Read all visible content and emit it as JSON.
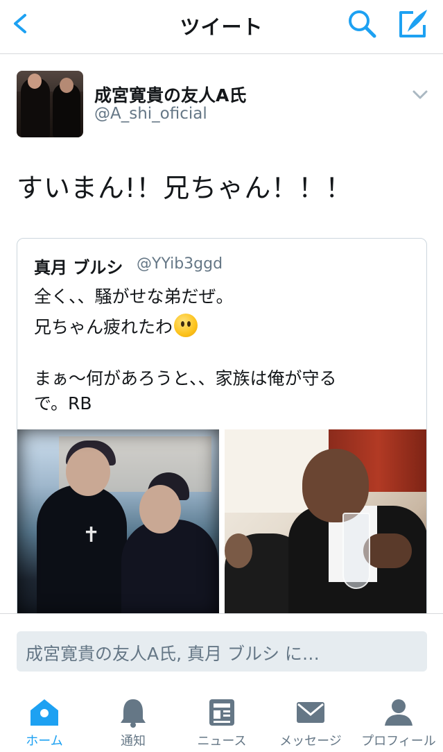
{
  "header": {
    "title": "ツイート",
    "back_icon": "chevron-left-icon",
    "search_icon": "search-icon",
    "compose_icon": "compose-tweet-icon",
    "accent_color": "#1da1f2"
  },
  "tweet": {
    "author_name": "成宮寛貴の友人A氏",
    "author_handle": "@A_shi_oficial",
    "text": "すいまん!！兄ちゃん！！！",
    "more_icon": "chevron-down-icon"
  },
  "quoted_tweet": {
    "author_name": "真月 ブルシ",
    "author_handle": "@YYib3ggd",
    "lines": [
      "全く、、騒がせな弟だぜ。",
      "兄ちゃん疲れたわ",
      "まぁ〜何があろうと、、家族は俺が守る",
      "で。RB"
    ],
    "emoji": "hushed-face-emoji"
  },
  "reply": {
    "placeholder": "成宮寛貴の友人A氏, 真月 ブルシ に…"
  },
  "tabbar": {
    "tabs": [
      {
        "label": "ホーム",
        "icon": "home-icon",
        "active": true
      },
      {
        "label": "通知",
        "icon": "bell-icon",
        "active": false
      },
      {
        "label": "ニュース",
        "icon": "news-icon",
        "active": false
      },
      {
        "label": "メッセージ",
        "icon": "envelope-icon",
        "active": false
      },
      {
        "label": "プロフィール",
        "icon": "person-icon",
        "active": false
      }
    ],
    "active_color": "#1da1f2",
    "inactive_color": "#657786"
  }
}
